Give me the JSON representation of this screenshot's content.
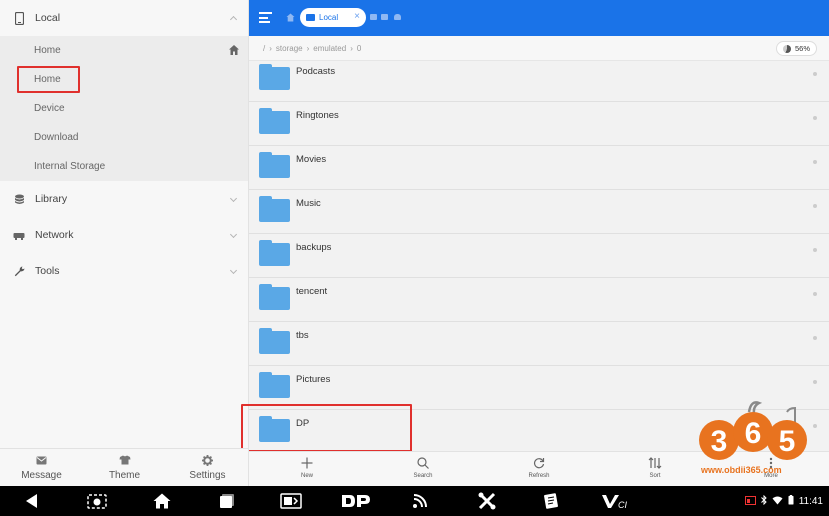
{
  "sidebar": {
    "local_label": "Local",
    "local_items": [
      "Home",
      "Home",
      "Device",
      "Download",
      "Internal Storage"
    ],
    "library_label": "Library",
    "network_label": "Network",
    "tools_label": "Tools",
    "bottom": [
      {
        "label": "Message",
        "icon": "message-icon"
      },
      {
        "label": "Theme",
        "icon": "shirt-icon"
      },
      {
        "label": "Settings",
        "icon": "gear-icon"
      }
    ]
  },
  "topbar": {
    "tab_label": "Local",
    "accent": "#1a73e8"
  },
  "breadcrumb": {
    "parts": [
      "/",
      "storage",
      "emulated",
      "0"
    ],
    "usage": "56%"
  },
  "files": [
    {
      "name": "Podcasts"
    },
    {
      "name": "Ringtones"
    },
    {
      "name": "Movies"
    },
    {
      "name": "Music"
    },
    {
      "name": "backups"
    },
    {
      "name": "tencent"
    },
    {
      "name": "tbs"
    },
    {
      "name": "Pictures"
    },
    {
      "name": "DP"
    }
  ],
  "toolbar": [
    {
      "label": "New",
      "icon": "plus-icon"
    },
    {
      "label": "Search",
      "icon": "search-icon"
    },
    {
      "label": "Refresh",
      "icon": "refresh-icon"
    },
    {
      "label": "Sort",
      "icon": "sort-icon"
    },
    {
      "label": "More",
      "icon": "more-icon"
    }
  ],
  "status_bar": {
    "time": "11:41"
  },
  "watermark": {
    "logo_text": "365",
    "url": "www.obdii365.com"
  },
  "colors": {
    "highlight_box": "#e0302d",
    "folder": "#5aa8e6"
  }
}
